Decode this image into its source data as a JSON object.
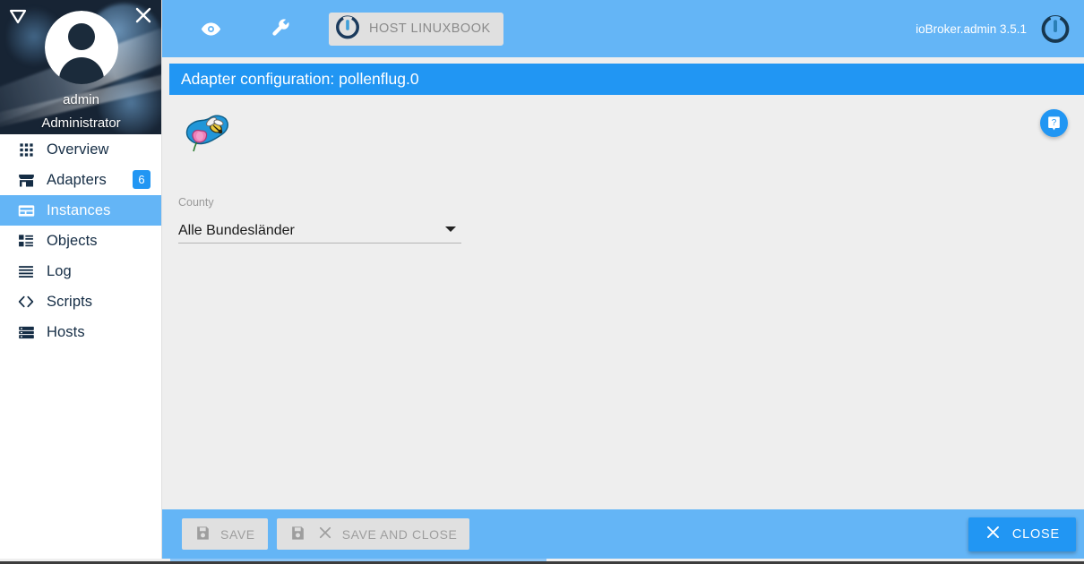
{
  "sidebar": {
    "menu_toggle_icon": "collapse-triangle-icon",
    "close_icon": "close-icon",
    "avatar_icon": "user-avatar-icon",
    "user_name": "admin",
    "user_role": "Administrator",
    "items": [
      {
        "label": "Overview",
        "icon": "grid-dots-icon",
        "selected": false,
        "badge": ""
      },
      {
        "label": "Adapters",
        "icon": "store-icon",
        "selected": false,
        "badge": "6"
      },
      {
        "label": "Instances",
        "icon": "instances-icon",
        "selected": true,
        "badge": ""
      },
      {
        "label": "Objects",
        "icon": "list-table-icon",
        "selected": false,
        "badge": ""
      },
      {
        "label": "Log",
        "icon": "lines-icon",
        "selected": false,
        "badge": ""
      },
      {
        "label": "Scripts",
        "icon": "code-brackets-icon",
        "selected": false,
        "badge": ""
      },
      {
        "label": "Hosts",
        "icon": "server-icon",
        "selected": false,
        "badge": ""
      }
    ]
  },
  "toolbar": {
    "eye_icon": "eye-icon",
    "wrench_icon": "wrench-icon",
    "host_button_label": "HOST LINUXBOOK",
    "host_button_icon": "iobroker-logo-icon",
    "version_label": "ioBroker.admin 3.5.1",
    "power_icon": "iobroker-power-logo-icon"
  },
  "title_bar": {
    "text": "Adapter configuration: pollenflug.0"
  },
  "content": {
    "adapter_logo_icon": "pollenflug-logo-icon",
    "help_icon": "help-book-icon",
    "field_label": "County",
    "select_value": "Alle Bundesländer",
    "select_caret_icon": "chevron-down-icon"
  },
  "bottom_bar": {
    "save_label": "SAVE",
    "save_icon": "floppy-save-icon",
    "save_close_label": "SAVE AND CLOSE",
    "save_close_icon": "floppy-save-icon",
    "save_close_x_icon": "close-x-icon",
    "close_label": "CLOSE",
    "close_icon": "close-x-icon"
  },
  "colors": {
    "toolbar_blue": "#64b5f6",
    "title_blue": "#2196f3",
    "accent_blue": "#2196f3",
    "content_bg": "#eeeeee",
    "sidebar_bg": "#ffffff",
    "menu_text": "#152d45",
    "disabled_btn_bg": "#e0e0e0",
    "disabled_btn_text": "#9e9e9e"
  }
}
